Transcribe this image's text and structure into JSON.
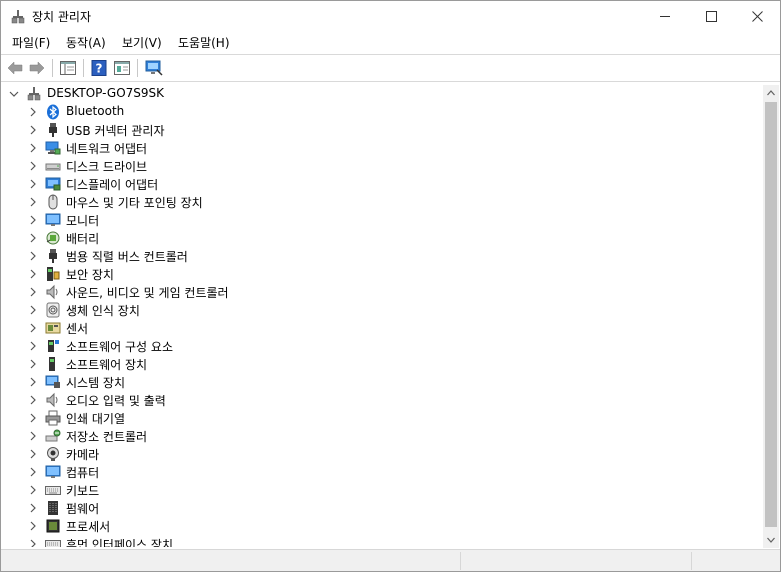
{
  "window": {
    "title": "장치 관리자"
  },
  "menu": [
    "파일(F)",
    "동작(A)",
    "보기(V)",
    "도움말(H)"
  ],
  "toolbar": {
    "buttons": [
      "back-icon",
      "forward-icon",
      "show-hide-console-tree-icon",
      "help-icon",
      "properties-icon",
      "scan-hardware-icon"
    ]
  },
  "tree": {
    "root": "DESKTOP-GO7S9SK",
    "items": [
      {
        "label": "Bluetooth",
        "icon": "bluetooth-icon"
      },
      {
        "label": "USB 커넥터 관리자",
        "icon": "usb-icon"
      },
      {
        "label": "네트워크 어댑터",
        "icon": "network-adapter-icon"
      },
      {
        "label": "디스크 드라이브",
        "icon": "disk-drive-icon"
      },
      {
        "label": "디스플레이 어댑터",
        "icon": "display-adapter-icon"
      },
      {
        "label": "마우스 및 기타 포인팅 장치",
        "icon": "mouse-icon"
      },
      {
        "label": "모니터",
        "icon": "monitor-icon"
      },
      {
        "label": "배터리",
        "icon": "battery-icon"
      },
      {
        "label": "범용 직렬 버스 컨트롤러",
        "icon": "usb-controller-icon"
      },
      {
        "label": "보안 장치",
        "icon": "security-device-icon"
      },
      {
        "label": "사운드, 비디오 및 게임 컨트롤러",
        "icon": "speaker-icon"
      },
      {
        "label": "생체 인식 장치",
        "icon": "fingerprint-icon"
      },
      {
        "label": "센서",
        "icon": "sensor-icon"
      },
      {
        "label": "소프트웨어 구성 요소",
        "icon": "software-component-icon"
      },
      {
        "label": "소프트웨어 장치",
        "icon": "software-device-icon"
      },
      {
        "label": "시스템 장치",
        "icon": "system-device-icon"
      },
      {
        "label": "오디오 입력 및 출력",
        "icon": "audio-io-icon"
      },
      {
        "label": "인쇄 대기열",
        "icon": "printer-icon"
      },
      {
        "label": "저장소 컨트롤러",
        "icon": "storage-controller-icon"
      },
      {
        "label": "카메라",
        "icon": "camera-icon"
      },
      {
        "label": "컴퓨터",
        "icon": "computer-icon"
      },
      {
        "label": "키보드",
        "icon": "keyboard-icon"
      },
      {
        "label": "펌웨어",
        "icon": "firmware-icon"
      },
      {
        "label": "프로세서",
        "icon": "processor-icon"
      },
      {
        "label": "휴먼 인터페이스 장치",
        "icon": "hid-icon"
      }
    ]
  },
  "colors": {
    "accent": "#0078d7",
    "scroll_thumb": "#c2c2c2",
    "statusbar": "#f0f0f0"
  }
}
